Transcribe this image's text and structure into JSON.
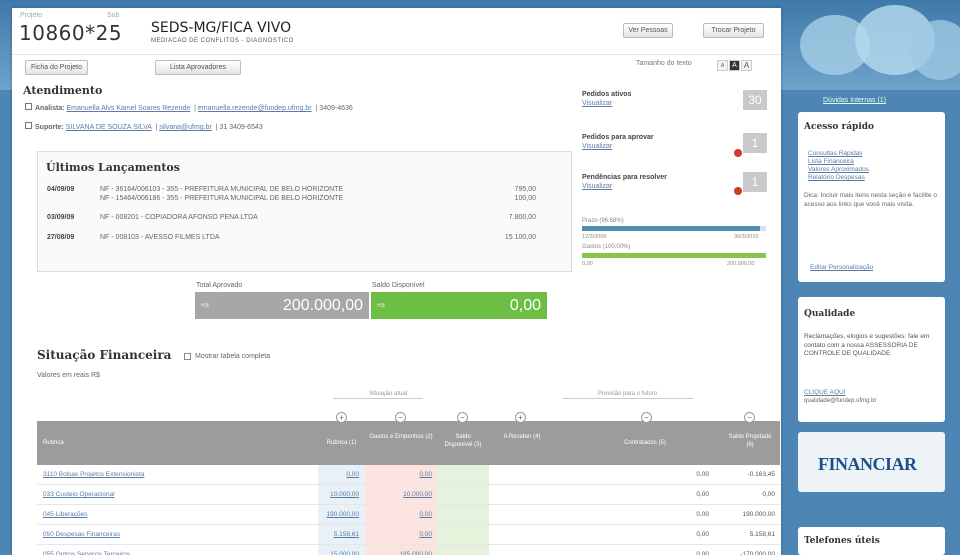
{
  "header": {
    "label_projeto": "Projeto",
    "label_sub": "Sub",
    "project_number": "10860*25",
    "title": "SEDS-MG/FICA VIVO",
    "subtitle": "MEDIACAO DE CONFLITOS - DIAGNOSTICO",
    "btn_ver_pessoas": "Ver Pessoas",
    "btn_trocar_projeto": "Trocar Projeto",
    "btn_ficha": "Ficha do Projeto",
    "btn_lista": "Lista Aprovadores",
    "fontsize_label": "Tamanho do texto",
    "fontsize_opts": [
      "A",
      "A",
      "A"
    ]
  },
  "atendimento": {
    "title": "Atendimento",
    "analista_label": "Analista:",
    "analista_name": "Emanuella Alvs Kamel Soares Rezende",
    "analista_email": "emanuella.rezende@fundep.ufmg.br",
    "analista_phone": "3409-4636",
    "suporte_label": "Suporte:",
    "suporte_name": "SILVANA DE SOUZA SILVA",
    "suporte_email": "silvana@ufmg.br",
    "suporte_phone": "31 3409-6543"
  },
  "lancamentos": {
    "title": "Últimos Lançamentos",
    "rows": [
      {
        "date": "04/09/09",
        "text": "NF - 36164/006103 - 355 - PREFEITURA MUNICIPAL DE BELO HORIZONTE",
        "value": "795,00"
      },
      {
        "date": "",
        "text": "NF - 15464/006186 - 355 - PREFEITURA MUNICIPAL DE BELO HORIZONTE",
        "value": "100,00"
      },
      {
        "date": "03/09/09",
        "text": "NF - 008201 - COPIADORA AFONSO PENA LTDA",
        "value": "7.800,00"
      },
      {
        "date": "27/08/09",
        "text": "NF - 008103 - AVESSO FILMES LTDA",
        "value": "15.100,00"
      }
    ]
  },
  "totals": {
    "aprovado_label": "Total Aprovado",
    "aprovado_cur": "R$",
    "aprovado_value": "200.000,00",
    "saldo_label": "Saldo Disponível",
    "saldo_cur": "R$",
    "saldo_value": "0,00"
  },
  "pedidos": {
    "ativos_title": "Pedidos ativos",
    "ativos_link": "Visualizar",
    "ativos_count": "30",
    "aprovar_title": "Pedidos para aprovar",
    "aprovar_link": "Visualizar",
    "aprovar_count": "1",
    "pend_title": "Pendências para resolver",
    "pend_link": "Visualizar",
    "pend_count": "1",
    "prazo_label": "Prazo (96.68%)",
    "prazo_start": "12/3/2009",
    "prazo_end": "30/3/2010",
    "prazo_fraction": 0.9668,
    "gastos_label": "Gastos (100,00%)",
    "gastos_start": "0,00",
    "gastos_end": "200.000,00",
    "gastos_fraction": 1.0
  },
  "situacao": {
    "title": "Situação Financeira",
    "checkbox_label": "Mostrar tabela completa",
    "valores_note": "Valores em reais R$",
    "group_atual": "Situação atual",
    "group_futuro": "Previsão para o futuro",
    "headers": [
      "Rubrica",
      "Rubrica (1)",
      "Gastos e Empenhos (2)",
      "Saldo Disponível (3)",
      "A Receber (4)",
      "Contratados (5)",
      "Saldo Projetado (6)"
    ],
    "rows": [
      {
        "rubrica": "3110 Bolsas Projetos Extensionista",
        "r1": "0,00",
        "r2": "0,00",
        "r3": "",
        "r5": "0,00",
        "r6": "-0.163,45"
      },
      {
        "rubrica": "033 Custeio Operacional",
        "r1": "10.000,00",
        "r2": "10.000,00",
        "r3": "",
        "r5": "0,00",
        "r6": "0,00"
      },
      {
        "rubrica": "045 Liberações",
        "r1": "190.000,00",
        "r2": "0,00",
        "r3": "",
        "r5": "0,00",
        "r6": "190.000,00"
      },
      {
        "rubrica": "050 Despesas Financeiras",
        "r1": "5.158,61",
        "r2": "0,00",
        "r3": "",
        "r5": "0,00",
        "r6": "5.158,61"
      },
      {
        "rubrica": "055 Outros Serviços Terceiros",
        "r1": "15.000,00",
        "r2": "185.000,00",
        "r3": "",
        "r5": "0,00",
        "r6": "-170.000,00"
      }
    ]
  },
  "sidebar": {
    "duvidas_link": "Dúvidas Internas (1)",
    "acesso_title": "Acesso rápido",
    "acesso_items": [
      "Consultas Rápidas",
      "Lista Financeira",
      "Valores Aproximados",
      "Relatório Despesas"
    ],
    "acesso_note": "Dica: Incluir mais itens nesta seção e facilite o acesso aos links que você mais visita.",
    "personalizar": "Editar Personalização",
    "qualidade_title": "Qualidade",
    "qualidade_text": "Reclamações, elogios e sugestões: fale em contato com a nossa ASSESSORIA DE CONTROLE DE QUALIDADE",
    "qualidade_link": "CLIQUE AQUI",
    "qualidade_email": "qualidade@fundep.ufmg.br",
    "logo_text": "FINANCIAR",
    "telefones_title": "Telefones úteis"
  },
  "colors": {
    "blue_bar": "#4f8fb0",
    "green_bar": "#8ac44a",
    "total_gray": "#a7a7a7",
    "saldo_green": "#6cbe45"
  }
}
